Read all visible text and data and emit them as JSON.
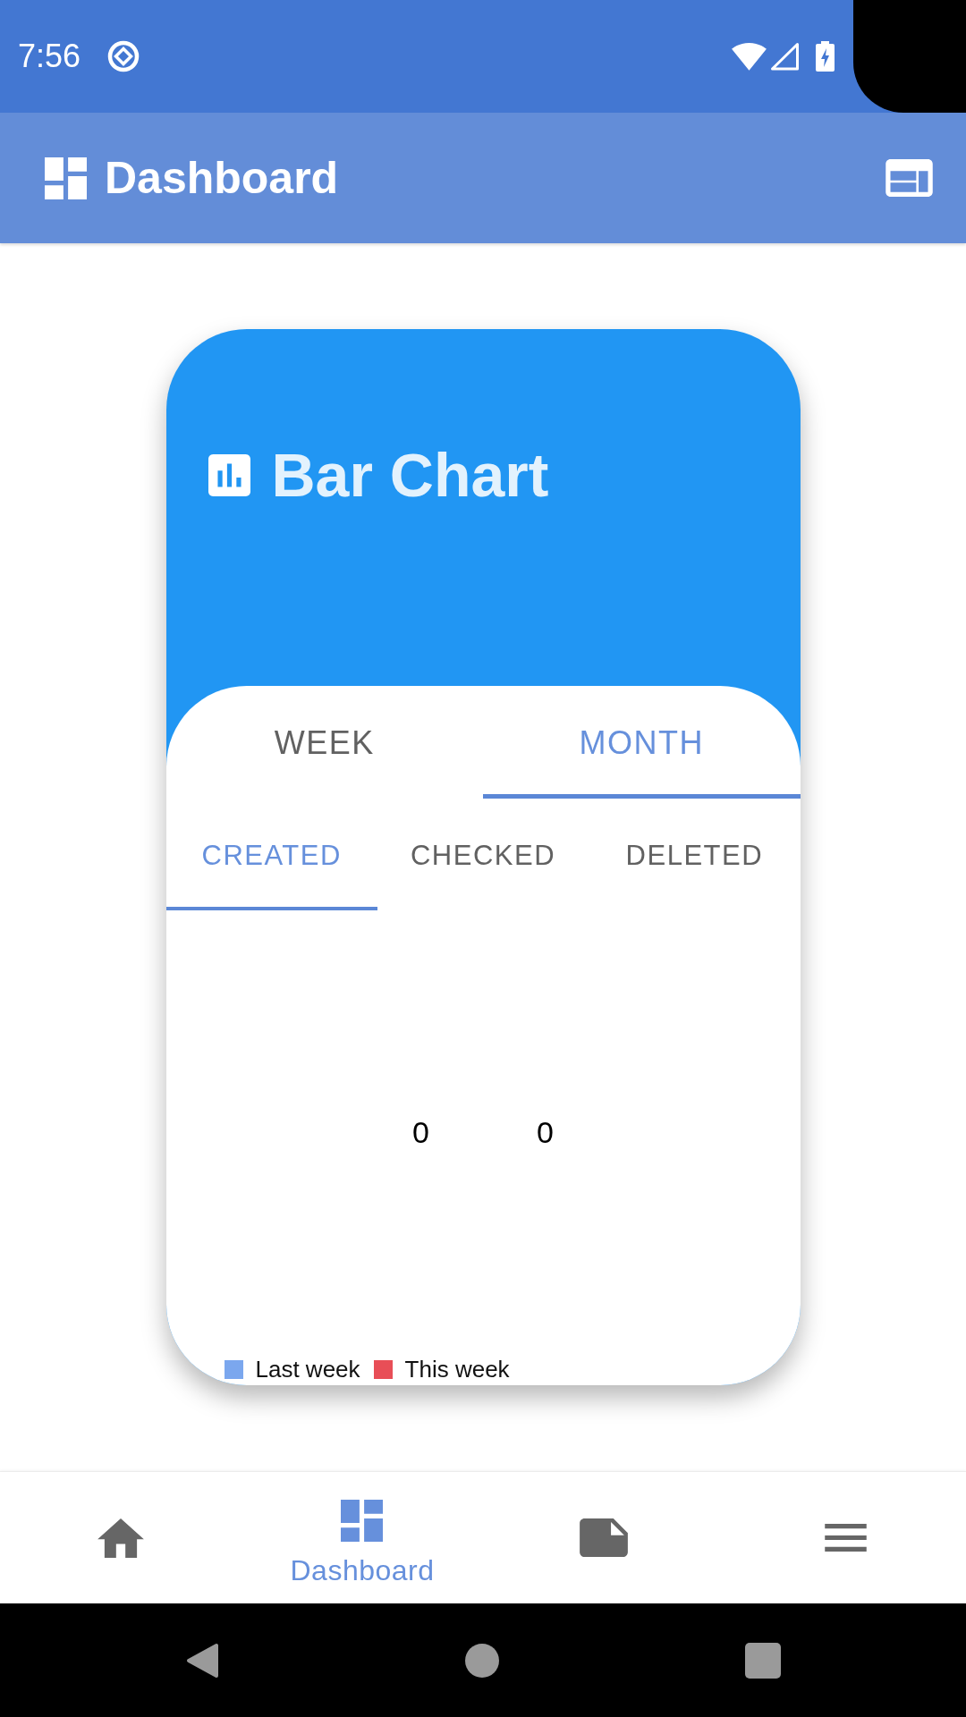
{
  "status_bar": {
    "time": "7:56"
  },
  "app_bar": {
    "title": "Dashboard"
  },
  "card": {
    "title": "Bar Chart",
    "period_tabs": [
      {
        "label": "WEEK",
        "selected": false
      },
      {
        "label": "MONTH",
        "selected": true
      }
    ],
    "metric_tabs": [
      {
        "label": "CREATED",
        "selected": true
      },
      {
        "label": "CHECKED",
        "selected": false
      },
      {
        "label": "DELETED",
        "selected": false
      }
    ],
    "chart": {
      "value_labels": [
        "0",
        "0"
      ],
      "legend": [
        {
          "label": "Last week",
          "color": "#7ba7ee"
        },
        {
          "label": "This week",
          "color": "#e84e57"
        }
      ]
    }
  },
  "bottom_nav": {
    "items": [
      {
        "kind": "home",
        "selected": false
      },
      {
        "kind": "dashboard",
        "label": "Dashboard",
        "selected": true
      },
      {
        "kind": "note",
        "selected": false
      },
      {
        "kind": "menu",
        "selected": false
      }
    ]
  }
}
